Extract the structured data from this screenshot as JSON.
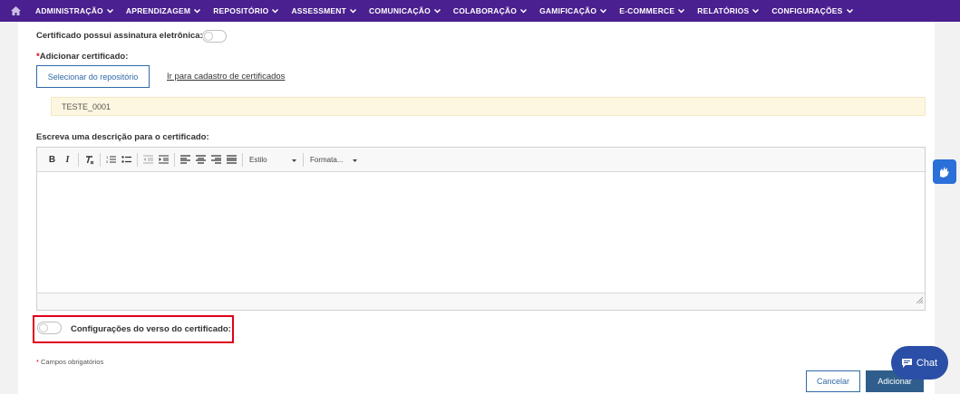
{
  "nav": {
    "items": [
      {
        "label": "ADMINISTRAÇÃO"
      },
      {
        "label": "APRENDIZAGEM"
      },
      {
        "label": "REPOSITÓRIO"
      },
      {
        "label": "ASSESSMENT"
      },
      {
        "label": "COMUNICAÇÃO"
      },
      {
        "label": "COLABORAÇÃO"
      },
      {
        "label": "GAMIFICAÇÃO"
      },
      {
        "label": "E-COMMERCE"
      },
      {
        "label": "RELATÓRIOS"
      },
      {
        "label": "CONFIGURAÇÕES"
      }
    ],
    "home_icon": "home-icon",
    "colors": {
      "bar": "#4a1f8f",
      "text": "#ffffff"
    }
  },
  "form": {
    "signature_label": "Certificado possui assinatura eletrônica:",
    "signature_enabled": false,
    "add_cert_required_mark": "*",
    "add_cert_label": "Adicionar certificado:",
    "select_repo_button": "Selecionar do repositório",
    "register_link": "Ir para cadastro de certificados",
    "selected_certificate": "TESTE_0001",
    "description_label": "Escreva uma descrição para o certificado:",
    "editor": {
      "style_combo": "Estilo",
      "format_combo": "Formata...",
      "content": ""
    },
    "back_config_label": "Configurações do verso do certificado:",
    "back_config_enabled": false,
    "required_note_mark": "*",
    "required_note": "Campos obrigatórios",
    "cancel_button": "Cancelar",
    "add_button": "Adicionar"
  },
  "widgets": {
    "chat_label": "Chat",
    "chat_icon": "chat-bubble-icon",
    "accessibility_icon": "sign-language-icon"
  },
  "colors": {
    "accent": "#2f6aa7",
    "highlight": "#e0001b",
    "cert_box": "#fdf7e1",
    "chat": "#2b4fa6"
  }
}
